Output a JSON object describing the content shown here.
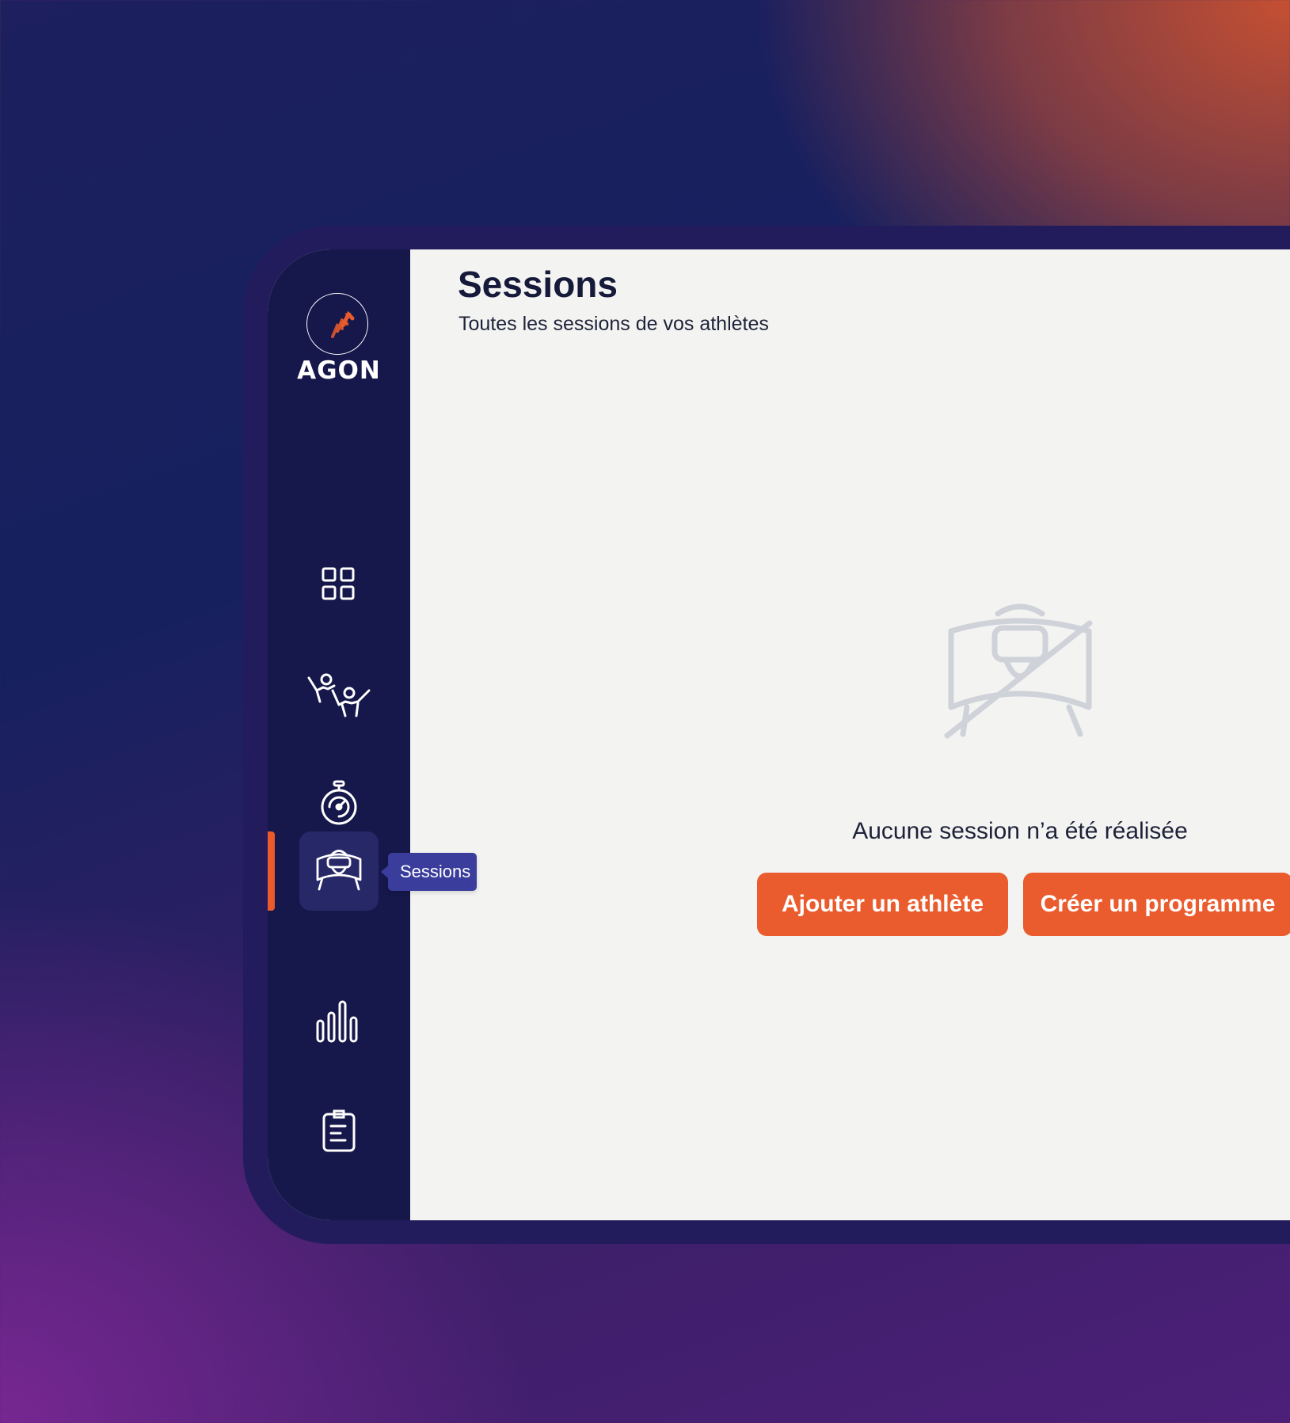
{
  "brand": {
    "name": "AGON",
    "accent_color": "#ea5c2d"
  },
  "sidebar": {
    "items": [
      {
        "id": "dashboard",
        "icon": "dashboard-grid-icon",
        "active": false
      },
      {
        "id": "athletes",
        "icon": "athletes-icon",
        "active": false
      },
      {
        "id": "stopwatch",
        "icon": "stopwatch-icon",
        "active": false
      },
      {
        "id": "sessions",
        "icon": "vr-headset-user-icon",
        "active": true,
        "tooltip": "Sessions"
      },
      {
        "id": "statistics",
        "icon": "bar-chart-icon",
        "active": false
      },
      {
        "id": "programs",
        "icon": "clipboard-icon",
        "active": false
      }
    ]
  },
  "header": {
    "title": "Sessions",
    "subtitle": "Toutes les sessions de vos athlètes"
  },
  "empty_state": {
    "icon": "no-sessions-icon",
    "message": "Aucune session n’a été réalisée",
    "actions": {
      "add_athlete": "Ajouter un athlète",
      "create_program": "Créer un programme"
    }
  }
}
